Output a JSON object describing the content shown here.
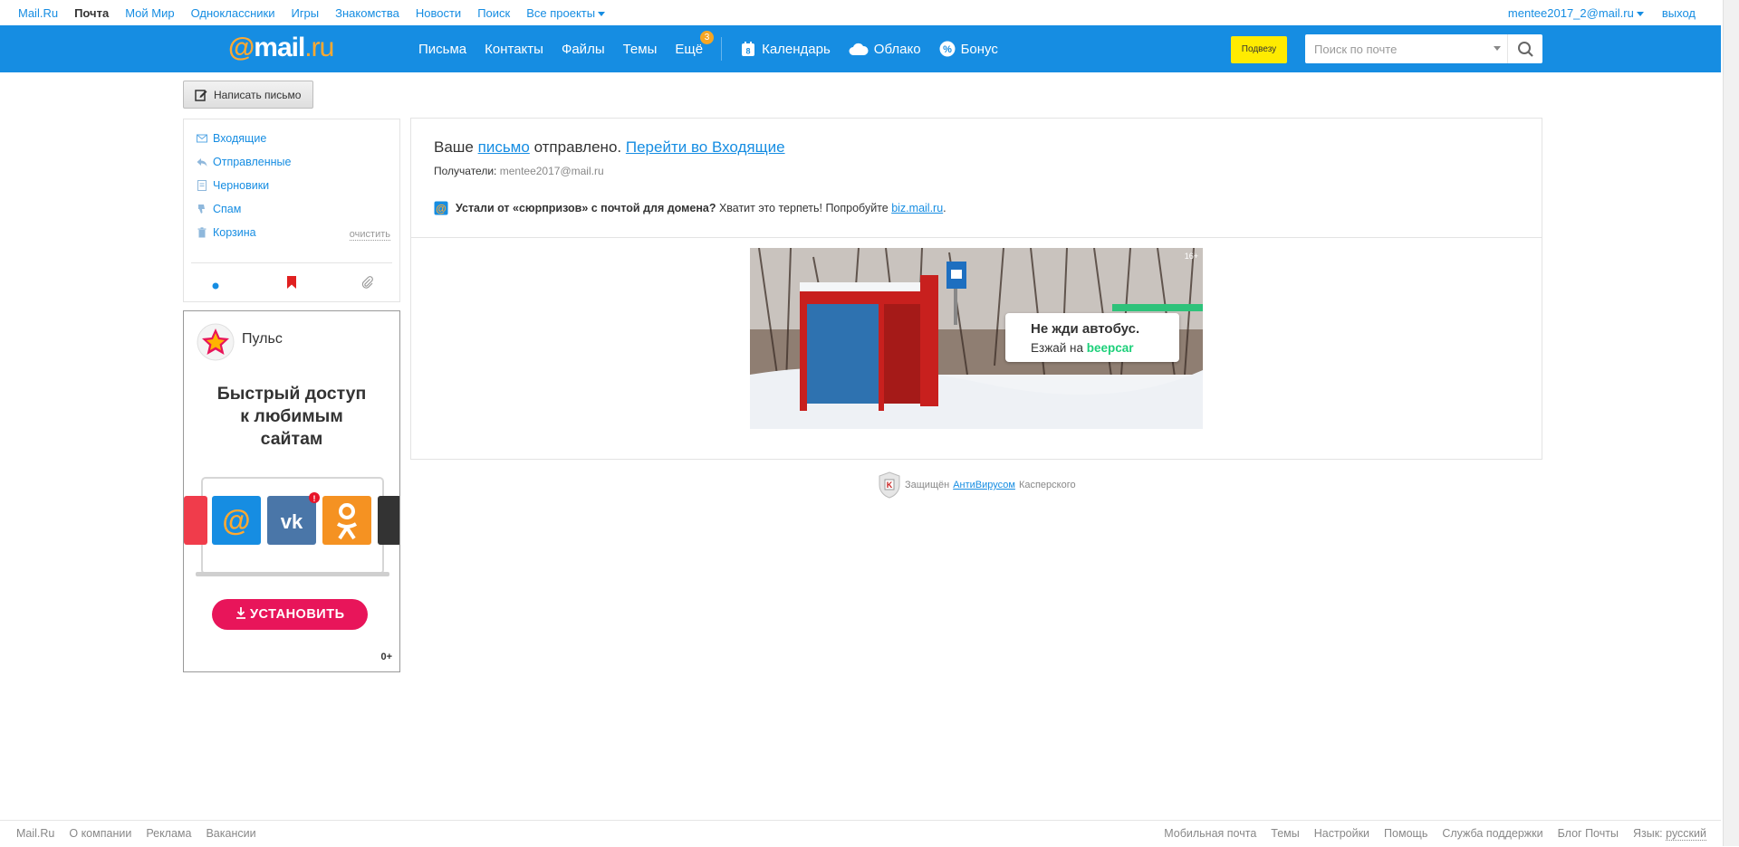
{
  "portal": {
    "links": [
      "Mail.Ru",
      "Почта",
      "Мой Мир",
      "Одноклассники",
      "Игры",
      "Знакомства",
      "Новости",
      "Поиск"
    ],
    "all_projects": "Все проекты",
    "user": "mentee2017_2@mail.ru",
    "logout": "выход"
  },
  "header": {
    "logo_at": "@",
    "logo_mail": "mail",
    "logo_ru": ".ru",
    "nav": {
      "letters": "Письма",
      "contacts": "Контакты",
      "files": "Файлы",
      "themes": "Темы",
      "more": "Ещё",
      "more_badge": "3",
      "calendar": "Календарь",
      "calendar_day": "8",
      "cloud": "Облако",
      "bonus": "Бонус"
    },
    "podvezu": "Подвезу",
    "search_placeholder": "Поиск по почте"
  },
  "compose": {
    "label": "Написать письмо"
  },
  "folders": {
    "items": [
      "Входящие",
      "Отправленные",
      "Черновики",
      "Спам",
      "Корзина"
    ],
    "clear": "очистить"
  },
  "ad": {
    "brand": "Пульс",
    "headline_1": "Быстрый доступ",
    "headline_2": "к любимым",
    "headline_3": "сайтам",
    "notif": "!",
    "install": "УСТАНОВИТЬ",
    "age": "0+"
  },
  "main": {
    "title_prefix": "Ваше",
    "title_link": "письмо",
    "title_mid": "отправлено.",
    "goto_inbox": "Перейти во Входящие",
    "recipients_label": "Получатели:",
    "recipients_value": "mentee2017@mail.ru",
    "promo_bold": "Устали от «сюрпризов» с почтой для домена?",
    "promo_text": "Хватит это терпеть! Попробуйте",
    "promo_link": "biz.mail.ru",
    "promo_end": "."
  },
  "banner": {
    "line1": "Не жди автобус.",
    "line2": "Езжай на",
    "brand": "beepcar",
    "rating": "16+"
  },
  "kaspersky": {
    "prefix": "Защищён",
    "link": "АнтиВирусом",
    "suffix": "Касперского"
  },
  "footer": {
    "left": [
      "Mail.Ru",
      "О компании",
      "Реклама",
      "Вакансии"
    ],
    "right": [
      "Мобильная почта",
      "Темы",
      "Настройки",
      "Помощь",
      "Служба поддержки",
      "Блог Почты"
    ],
    "lang_label": "Язык:",
    "lang_value": "русский"
  },
  "colors": {
    "header_blue": "#168de2",
    "accent_orange": "#ffa930",
    "podvezu_yellow": "#ffeb00",
    "install_pink": "#e8155a"
  }
}
